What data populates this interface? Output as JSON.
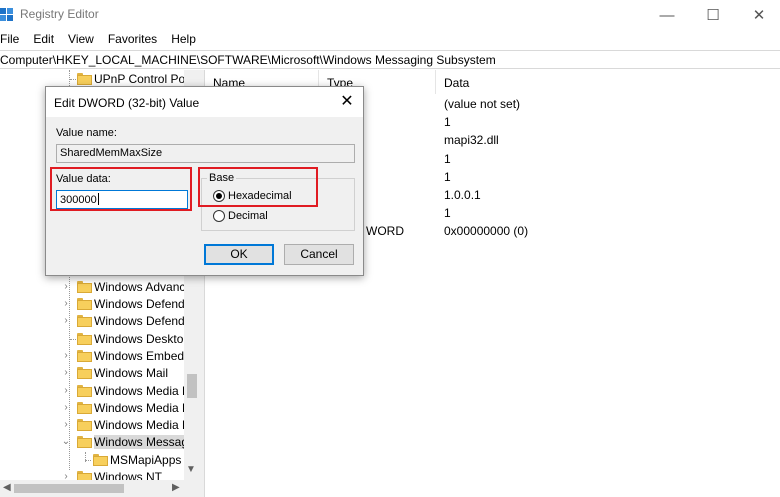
{
  "window": {
    "title": "Registry Editor",
    "minimize_glyph": "—",
    "maximize_glyph": "☐",
    "close_glyph": "✕"
  },
  "menu": [
    "File",
    "Edit",
    "View",
    "Favorites",
    "Help"
  ],
  "address": "Computer\\HKEY_LOCAL_MACHINE\\SOFTWARE\\Microsoft\\Windows Messaging Subsystem",
  "tree": {
    "items": [
      {
        "label": "UPnP Control Poi",
        "expander": ""
      },
      {
        "label": "Windows Advanc",
        "expander": "›"
      },
      {
        "label": "Windows Defend",
        "expander": "›"
      },
      {
        "label": "Windows Defend",
        "expander": "›"
      },
      {
        "label": "Windows Desktop",
        "expander": ""
      },
      {
        "label": "Windows Embedd",
        "expander": "›"
      },
      {
        "label": "Windows Mail",
        "expander": "›"
      },
      {
        "label": "Windows Media D",
        "expander": "›"
      },
      {
        "label": "Windows Media F",
        "expander": "›"
      },
      {
        "label": "Windows Media F",
        "expander": "›"
      },
      {
        "label": "Windows Messag",
        "expander": "⌄"
      },
      {
        "label": "MSMapiApps",
        "expander": ""
      },
      {
        "label": "Windows NT",
        "expander": "›"
      }
    ]
  },
  "list": {
    "columns": {
      "name": "Name",
      "type": "Type",
      "data": "Data"
    },
    "data_values": [
      "(value not set)",
      "1",
      "mapi32.dll",
      "1",
      "1",
      "1.0.0.1",
      "1",
      "0x00000000 (0)"
    ],
    "type_fragment": "WORD"
  },
  "dialog": {
    "title": "Edit DWORD (32-bit) Value",
    "close_glyph": "✕",
    "value_name_label": "Value name:",
    "value_name": "SharedMemMaxSize",
    "value_data_label": "Value data:",
    "value_data": "300000",
    "base_label": "Base",
    "hex_label": "Hexadecimal",
    "dec_label": "Decimal",
    "base_selected": "Hexadecimal",
    "ok_label": "OK",
    "cancel_label": "Cancel"
  },
  "colors": {
    "highlight": "#e01b22",
    "accent": "#0078d7",
    "folder": "#f7cf5c"
  }
}
